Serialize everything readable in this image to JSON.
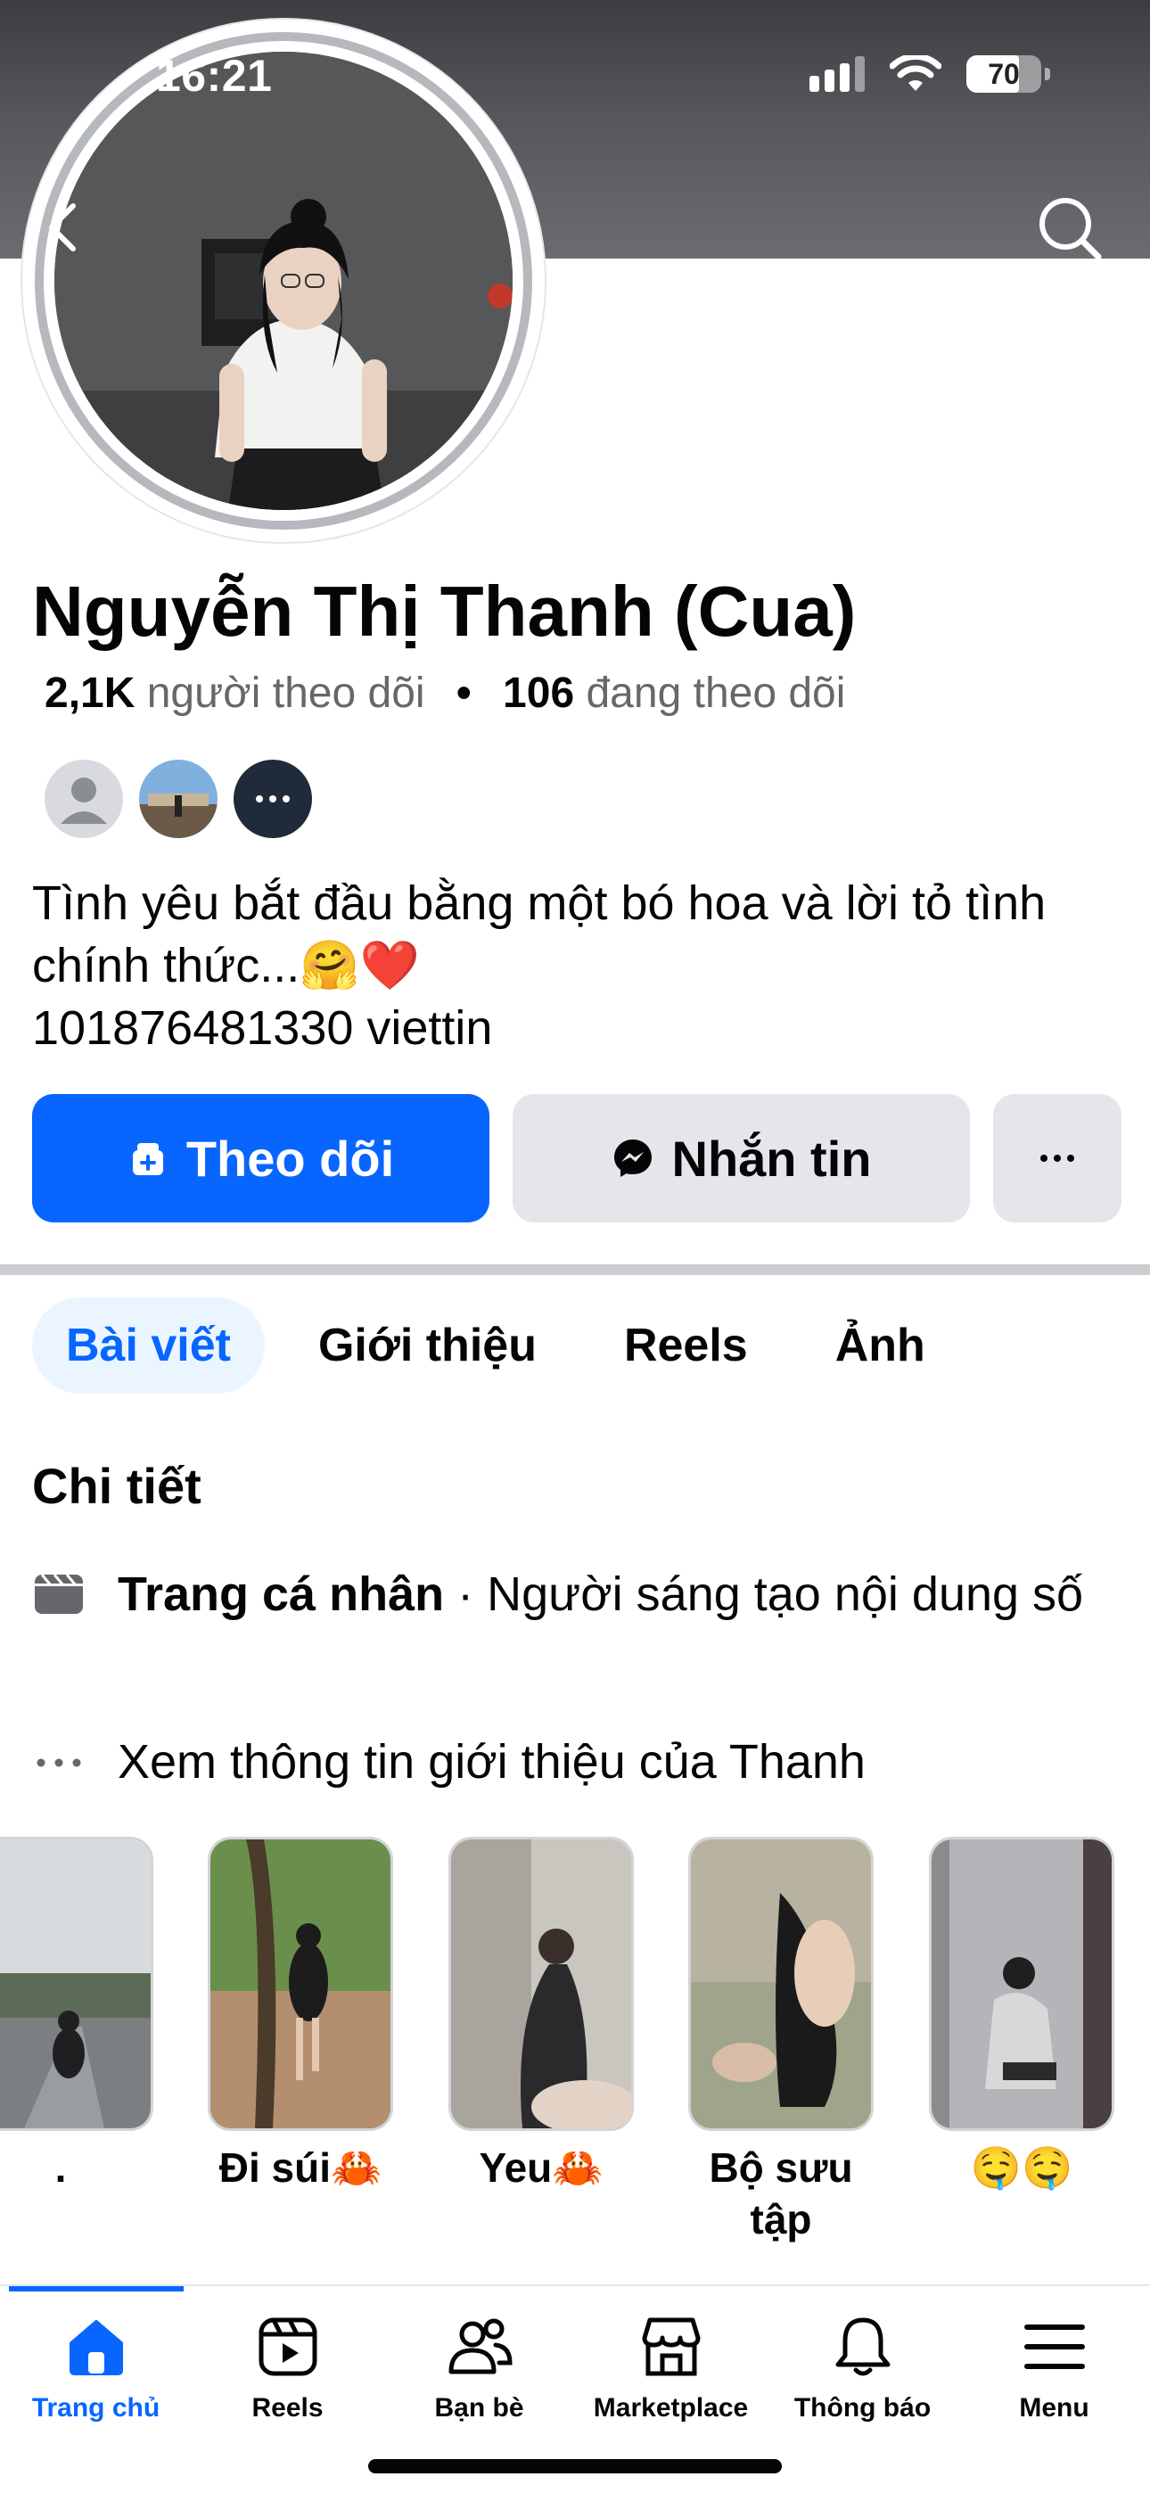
{
  "status_bar": {
    "time": "16:21",
    "battery": "70",
    "battery_level_percent": 70
  },
  "profile": {
    "name": "Nguyễn Thị Thanh (Cua)",
    "followers_count": "2,1K",
    "followers_label": "người theo dõi",
    "following_count": "106",
    "following_label": "đang theo dõi",
    "bio_line1": "Tình yêu bắt đầu bằng một bó hoa và lời tỏ tình chính thức...🤗❤️",
    "bio_line2": "101876481330 viettin"
  },
  "actions": {
    "follow_label": "Theo dõi",
    "message_label": "Nhắn tin"
  },
  "tabs": [
    {
      "label": "Bài viết",
      "active": true
    },
    {
      "label": "Giới thiệu",
      "active": false
    },
    {
      "label": "Reels",
      "active": false
    },
    {
      "label": "Ảnh",
      "active": false
    }
  ],
  "details": {
    "title": "Chi tiết",
    "page_type_bold": "Trang cá nhân",
    "page_type_rest": " · Người sáng tạo nội dung số",
    "see_about": "Xem thông tin giới thiệu của Thanh"
  },
  "featured": [
    {
      "label": "."
    },
    {
      "label": "Đi súi🦀"
    },
    {
      "label": "Yeu🦀"
    },
    {
      "label": "Bộ sưu tập"
    },
    {
      "label": "🤤🤤"
    }
  ],
  "bottom_nav": [
    {
      "label": "Trang chủ",
      "icon": "home-icon",
      "active": true
    },
    {
      "label": "Reels",
      "icon": "reels-icon",
      "active": false
    },
    {
      "label": "Bạn bè",
      "icon": "friends-icon",
      "active": false
    },
    {
      "label": "Marketplace",
      "icon": "marketplace-icon",
      "active": false
    },
    {
      "label": "Thông báo",
      "icon": "bell-icon",
      "active": false
    },
    {
      "label": "Menu",
      "icon": "menu-icon",
      "active": false
    }
  ],
  "colors": {
    "accent": "#0866ff",
    "secondary_button": "#e4e6eb",
    "text_secondary": "#65676b",
    "active_tab_bg": "#ebf5ff"
  }
}
